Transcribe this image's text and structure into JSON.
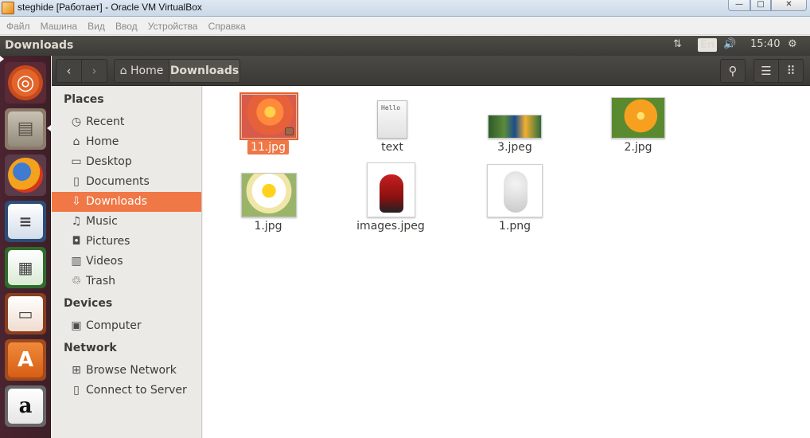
{
  "host_window": {
    "title": "steghide [Работает] - Oracle VM VirtualBox",
    "buttons": {
      "minimize": "—",
      "maximize": "□",
      "close": "✕"
    }
  },
  "vbox_menu": [
    "Файл",
    "Машина",
    "Вид",
    "Ввод",
    "Устройства",
    "Справка"
  ],
  "top_panel": {
    "app_title": "Downloads",
    "network_icon": "⇅",
    "keyboard_layout": "En",
    "volume_icon": "🔊",
    "clock": "15:40",
    "settings_icon": "⚙"
  },
  "launcher": [
    {
      "name": "ubuntu-dash",
      "glyph": "◎"
    },
    {
      "name": "files",
      "glyph": "▤"
    },
    {
      "name": "firefox",
      "glyph": ""
    },
    {
      "name": "libreoffice-writer",
      "glyph": "≡"
    },
    {
      "name": "libreoffice-calc",
      "glyph": "▦"
    },
    {
      "name": "libreoffice-impress",
      "glyph": "▭"
    },
    {
      "name": "ubuntu-software",
      "glyph": "A"
    },
    {
      "name": "amazon",
      "glyph": "a"
    }
  ],
  "header": {
    "back": "‹",
    "forward": "›",
    "breadcrumbs": [
      "Home",
      "Downloads"
    ],
    "home_icon": "⌂",
    "search_icon": "⚲",
    "list_icon": "☰",
    "grid_icon": "⠿"
  },
  "sidebar": {
    "sections": [
      {
        "title": "Places",
        "items": [
          {
            "label": "Recent",
            "icon": "◷",
            "selected": false
          },
          {
            "label": "Home",
            "icon": "⌂",
            "selected": false
          },
          {
            "label": "Desktop",
            "icon": "▭",
            "selected": false
          },
          {
            "label": "Documents",
            "icon": "▯",
            "selected": false
          },
          {
            "label": "Downloads",
            "icon": "⇩",
            "selected": true
          },
          {
            "label": "Music",
            "icon": "♫",
            "selected": false
          },
          {
            "label": "Pictures",
            "icon": "◘",
            "selected": false
          },
          {
            "label": "Videos",
            "icon": "▥",
            "selected": false
          },
          {
            "label": "Trash",
            "icon": "♲",
            "selected": false
          }
        ]
      },
      {
        "title": "Devices",
        "items": [
          {
            "label": "Computer",
            "icon": "▣",
            "selected": false
          }
        ]
      },
      {
        "title": "Network",
        "items": [
          {
            "label": "Browse Network",
            "icon": "⊞",
            "selected": false
          },
          {
            "label": "Connect to Server",
            "icon": "▯",
            "selected": false
          }
        ]
      }
    ]
  },
  "files": [
    {
      "name": "11.jpg",
      "selected": true,
      "locked": true
    },
    {
      "name": "text",
      "selected": false,
      "preview_text": "Hello"
    },
    {
      "name": "3.jpeg",
      "selected": false
    },
    {
      "name": "2.jpg",
      "selected": false
    },
    {
      "name": "1.jpg",
      "selected": false
    },
    {
      "name": "images.jpeg",
      "selected": false
    },
    {
      "name": "1.png",
      "selected": false
    }
  ],
  "colors": {
    "accent": "#f07746",
    "panel_dark": "#3c3b37",
    "sidebar_bg": "#eceae6",
    "launcher_bg": "#4a2430"
  }
}
